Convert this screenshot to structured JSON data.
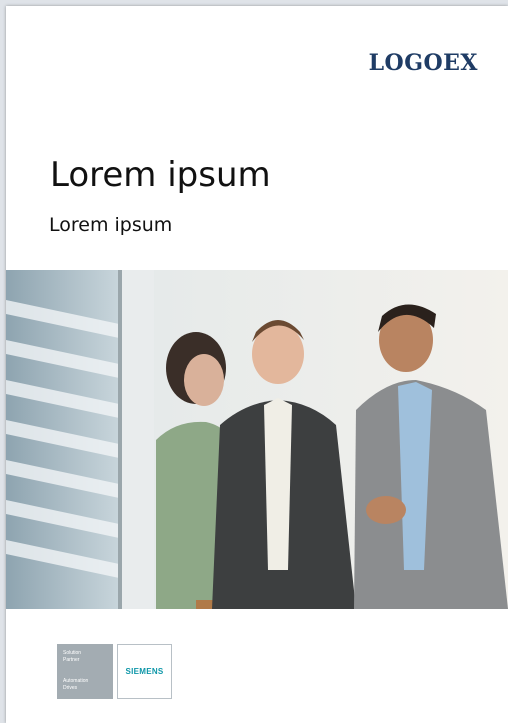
{
  "header": {
    "logo": "LOGOEX"
  },
  "cover": {
    "title": "Lorem ipsum",
    "subtitle": "Lorem ipsum"
  },
  "photo": {
    "alt": "three-business-people-photo"
  },
  "badge": {
    "line1": "Solution",
    "line2": "Partner",
    "line3": "Automation",
    "line4": "Drives",
    "brand": "SIEMENS"
  },
  "colors": {
    "logo": "#1f3c65",
    "siemens": "#0d96a8",
    "badge_gray": "#a3acb2"
  }
}
